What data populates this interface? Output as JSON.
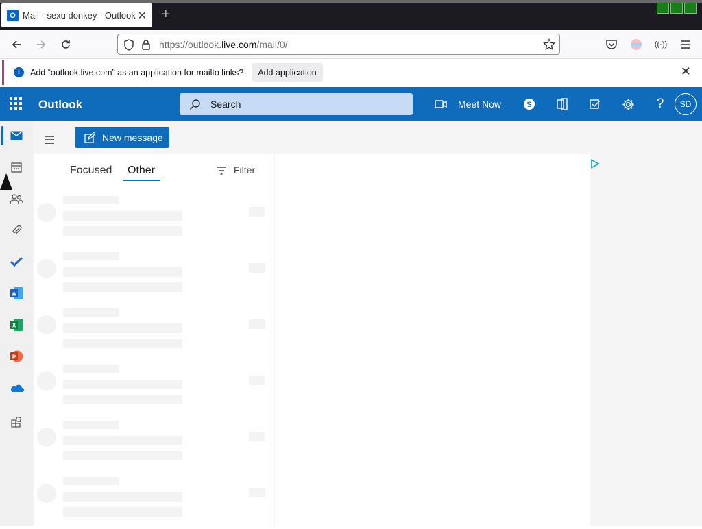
{
  "browser": {
    "tab_title": "Mail - sexu donkey - Outlook",
    "tab_close": "✕",
    "new_tab": "+",
    "url_prefix": "https://outlook.",
    "url_domain": "live.com",
    "url_path": "/mail/0/"
  },
  "infobar": {
    "message": "Add “outlook.live.com” as an application for mailto links?",
    "button": "Add application",
    "close": "✕"
  },
  "outlook": {
    "brand": "Outlook",
    "search_placeholder": "Search",
    "meet_now": "Meet Now",
    "avatar_initials": "SD",
    "accent": "#0f6cbd",
    "new_message": "New message",
    "tabs": [
      "Focused",
      "Other"
    ],
    "active_tab": "Other",
    "filter": "Filter"
  },
  "rail": {
    "items": [
      "mail-icon",
      "calendar-icon",
      "people-icon",
      "attachment-icon",
      "todo-icon",
      "word-icon",
      "excel-icon",
      "powerpoint-icon",
      "onedrive-icon",
      "apps-icon"
    ]
  }
}
